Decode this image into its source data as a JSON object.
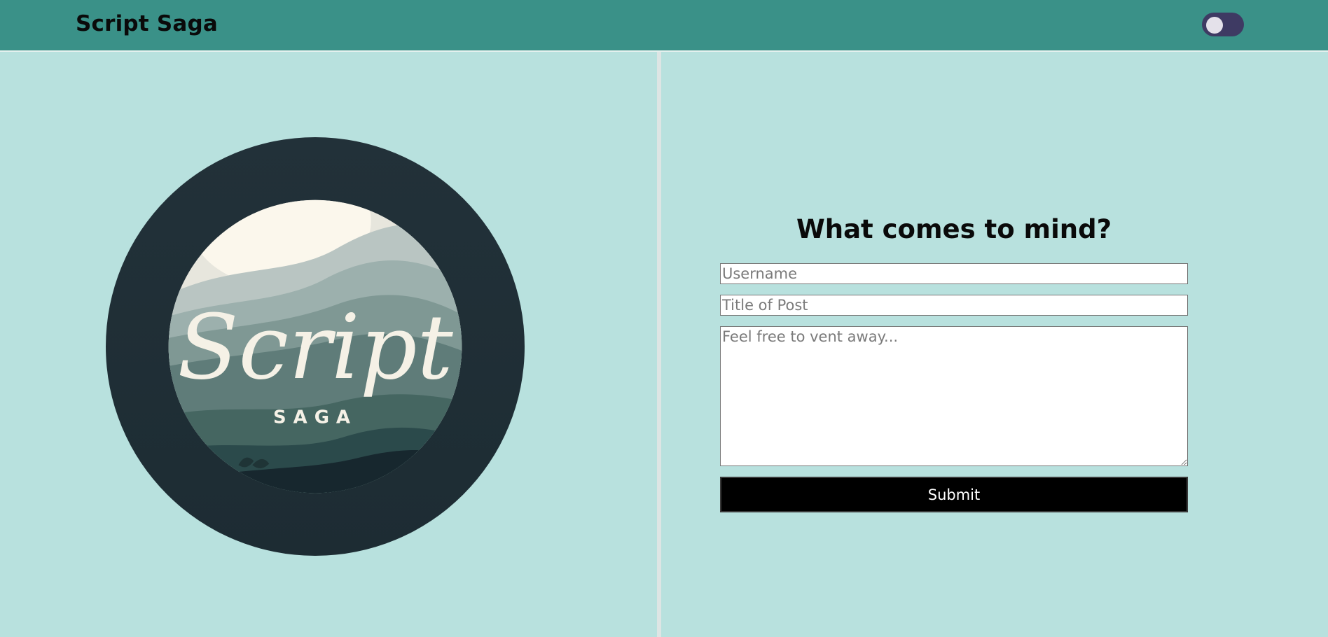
{
  "header": {
    "brand": "Script Saga",
    "theme_toggle": {
      "state": "off"
    }
  },
  "logo": {
    "wordmark": "Script",
    "tagline": "SAGA",
    "colors": {
      "ring": "#213039",
      "cream": "#f5f1e6"
    }
  },
  "form": {
    "title": "What comes to mind?",
    "username_placeholder": "Username",
    "title_placeholder": "Title of Post",
    "body_placeholder": "Feel free to vent away...",
    "submit_label": "Submit"
  },
  "colors": {
    "header": "#3a9188",
    "background": "#b8e1de",
    "toggle": "#3e3a63",
    "button": "#000000"
  },
  "icons": {
    "toggle": "toggle-switch-icon"
  }
}
